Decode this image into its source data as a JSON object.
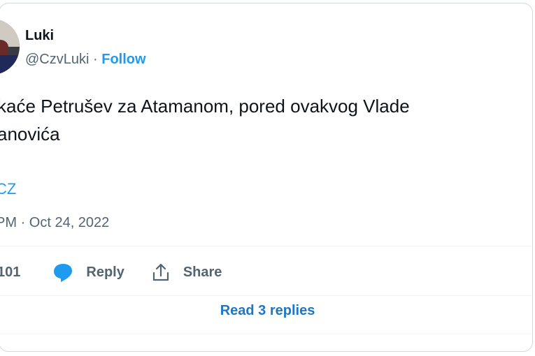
{
  "user": {
    "name": "Luki",
    "handle": "@CzvLuki",
    "separator": "·",
    "follow_label": "Follow"
  },
  "tweet": {
    "text_line1": "kaće Petrušev za Atamanom, pored ovakvog Vlade",
    "text_line2": "anovića",
    "tag": "CZ",
    "time": "PM · Oct 24, 2022"
  },
  "actions": {
    "like_count": "101",
    "reply_label": "Reply",
    "share_label": "Share",
    "read_replies_label": "Read 3 replies"
  },
  "colors": {
    "accent": "#1d9bf0",
    "secondary_text": "#536471"
  }
}
